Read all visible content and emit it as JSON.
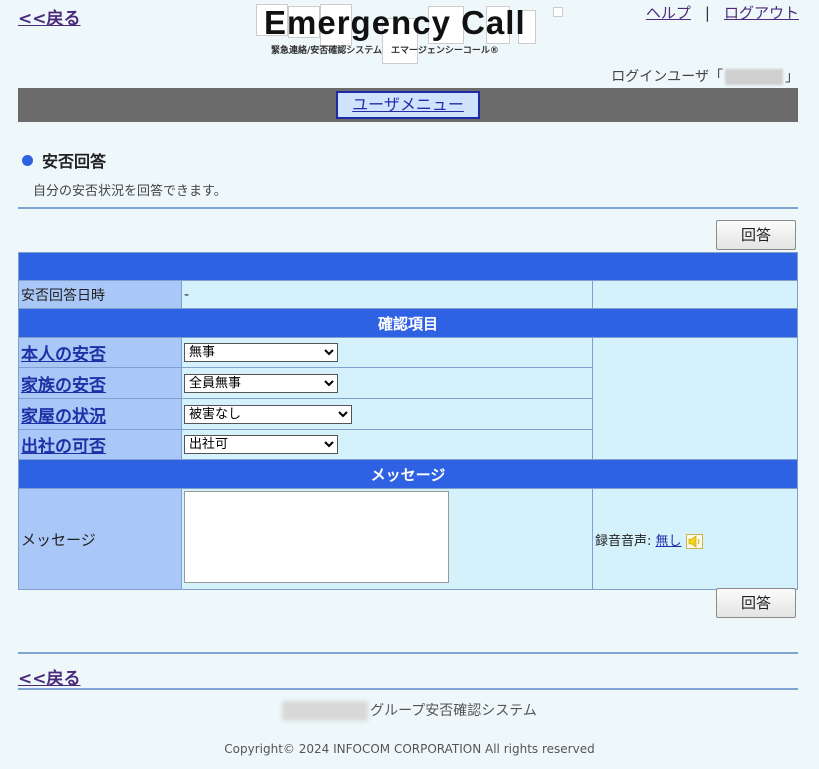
{
  "nav": {
    "back": "<<戻る",
    "help": "ヘルプ",
    "separator": "|",
    "logout": "ログアウト"
  },
  "logo": {
    "title": "Emergency Call",
    "subtitle": "緊急連絡/安否確認システム　エマージェンシーコール®"
  },
  "login": {
    "prefix": "ログインユーザ「",
    "suffix": "」"
  },
  "menu": {
    "user_menu": "ユーザメニュー"
  },
  "section": {
    "title": "安否回答",
    "description": "自分の安否状況を回答できます。"
  },
  "buttons": {
    "answer": "回答"
  },
  "form": {
    "answer_datetime_label": "安否回答日時",
    "answer_datetime_value": "-",
    "confirm_header": "確認項目",
    "items": [
      {
        "label": "本人の安否",
        "selected": "無事"
      },
      {
        "label": "家族の安否",
        "selected": "全員無事"
      },
      {
        "label": "家屋の状況",
        "selected": "被害なし"
      },
      {
        "label": "出社の可否",
        "selected": "出社可"
      }
    ],
    "message_header": "メッセージ",
    "message_label": "メッセージ",
    "message_value": "",
    "recording_label": "録音音声:",
    "recording_value": "無し"
  },
  "footer": {
    "system_name": "グループ安否確認システム",
    "copyright": "Copyright© 2024 INFOCOM CORPORATION All rights reserved"
  },
  "colors": {
    "accent": "#2f62e3",
    "label_bg": "#a9c8f7",
    "value_bg": "#d5f2fc",
    "menubar": "#6b6b6b"
  }
}
